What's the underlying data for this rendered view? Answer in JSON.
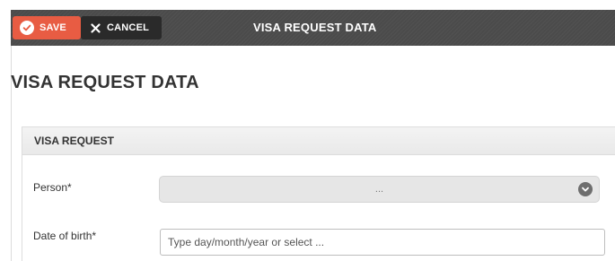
{
  "toolbar": {
    "save_label": "SAVE",
    "cancel_label": "CANCEL",
    "title": "VISA REQUEST DATA"
  },
  "page": {
    "title": "VISA REQUEST DATA"
  },
  "section": {
    "title": "VISA REQUEST"
  },
  "fields": {
    "person": {
      "label": "Person*",
      "value": "..."
    },
    "date_of_birth": {
      "label": "Date of birth*",
      "value": "",
      "placeholder": "Type day/month/year or select ..."
    }
  },
  "colors": {
    "save_button": "#e85c43",
    "cancel_button": "#2a2a2a",
    "toolbar": "#4b4b4b"
  },
  "icons": {
    "save": "check-circle-icon",
    "cancel": "close-icon",
    "person_select": "chevron-down-icon"
  }
}
